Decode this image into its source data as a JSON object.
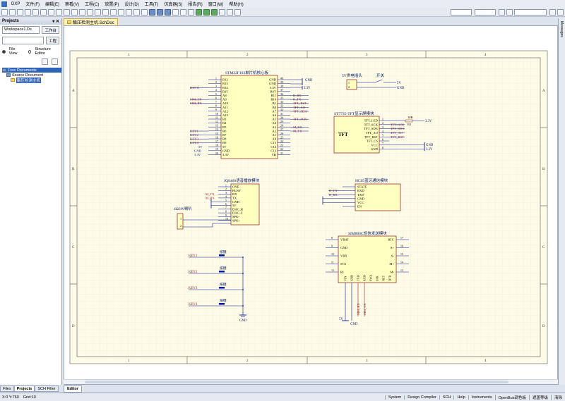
{
  "menu": {
    "app": "DXP",
    "items": [
      "文件(F)",
      "编辑(E)",
      "察看(V)",
      "工程(C)",
      "放置(P)",
      "设计(D)",
      "工具(T)",
      "仿真器(S)",
      "报告(R)",
      "窗口(W)",
      "帮助(H)"
    ]
  },
  "projects_panel": {
    "title": "Projects",
    "workspace_select": "Workspace1.Ds",
    "workspace_btn": "工作台",
    "project_btn": "工程",
    "file_view": "File View",
    "structure_editor": "Structure Editor",
    "tree": {
      "free_documents": "Free Documents",
      "source_documents": "Source Document",
      "file": "酯压检测主机"
    }
  },
  "bottom_tabs": [
    "Files",
    "Projects",
    "SCH Filter"
  ],
  "document_tab": "酯压检测主机.SchDoc",
  "editor_tab": "Editor",
  "right_panel": "Messages",
  "status": {
    "coords": "X:0 Y:760",
    "grid": "Grid:10",
    "tabs": [
      "System",
      "Design Compiler",
      "SCH",
      "Help",
      "Instruments",
      "OpenBus调色板"
    ],
    "mask": "遮盖等级",
    "clear": "清除"
  },
  "sheet": {
    "col_labels": [
      "1",
      "2",
      "3",
      "4"
    ],
    "row_labels": [
      "A",
      "B",
      "C",
      "D"
    ]
  },
  "schematic": {
    "stm32": {
      "title": "STM32F103单片机核心板",
      "left_pins": [
        "B12",
        "B13",
        "B14",
        "B15",
        "A8",
        "A9",
        "A10",
        "A11",
        "A12",
        "A15",
        "B3",
        "B4",
        "B5",
        "B6",
        "B7",
        "B8",
        "B9",
        "5V",
        "GND",
        "3.3V"
      ],
      "left_nums": [
        "1",
        "2",
        "3",
        "4",
        "5",
        "6",
        "7",
        "8",
        "9",
        "10",
        "11",
        "12",
        "13",
        "14",
        "15",
        "16",
        "17",
        "18",
        "19",
        "20"
      ],
      "right_pins": [
        "GND",
        "GND",
        "3.3V",
        "RST",
        "B11",
        "B10",
        "B1",
        "B0",
        "A7",
        "A6",
        "A5",
        "A4",
        "A3",
        "A2",
        "A1",
        "A0",
        "C15",
        "C14",
        "C13",
        "VB"
      ],
      "right_nums": [
        "40",
        "39",
        "38",
        "37",
        "36",
        "35",
        "34",
        "33",
        "32",
        "31",
        "30",
        "29",
        "28",
        "27",
        "26",
        "25",
        "24",
        "23",
        "22",
        "21"
      ],
      "left_nets": {
        "B14": "DHT11",
        "A9": "SIM_TX",
        "A10": "SIM_RX",
        "B6": "KEY1",
        "B7": "KEY2",
        "B8": "KEY3",
        "B9": "KEY4"
      },
      "right_nets": {
        "B11": "B_RX",
        "B10": "B_TX",
        "B1": "TFT_RST",
        "B0": "TFT_AO",
        "A7": "TFT_SDA",
        "A5": "TFT_SCK",
        "A3": "M_RX",
        "A2": "M_TX"
      },
      "gnd": "GND",
      "v33": "3.3V",
      "v5": "5V"
    },
    "power": {
      "title": "5V供电插头",
      "switch": "开关",
      "v5": "5V",
      "gnd": "GND"
    },
    "tft": {
      "title": "ST7735-TFT显示屏模块",
      "body": "TFT",
      "pins": [
        "TFT_LED",
        "TFT_SCK",
        "TFT_SDA",
        "TFT_AO",
        "TFT_RST",
        "TFT_CS",
        "VCC",
        "GND"
      ],
      "nums": [
        "1",
        "2",
        "3",
        "4",
        "5",
        "6",
        "7",
        "8"
      ],
      "nets": [
        "",
        "TFT_SCK",
        "TFT_SDA",
        "TFT_AO",
        "TFT_RST",
        "",
        "",
        ""
      ],
      "resistor": "R1",
      "res_value": "10R",
      "v33": "3.3V",
      "gnd": "GND"
    },
    "jq8400": {
      "title": "JQ8400语音播放模块",
      "pins": [
        "ONE",
        "BUSY",
        "RX",
        "TX",
        "GND",
        "5V",
        "DAC_R",
        "DAC_L",
        "SPK-",
        "SPK+"
      ],
      "nums": [
        "1",
        "2",
        "3",
        "4",
        "5",
        "6",
        "7",
        "8",
        "9",
        "10"
      ],
      "nets": {
        "RX": "M_TX",
        "TX": "M_RX"
      },
      "speaker": "4Ω3W喇叭",
      "spk_pins": [
        "1",
        "2"
      ]
    },
    "hc05": {
      "title": "HC05蓝牙通信模块",
      "pins": [
        "STATE",
        "RXD",
        "TXD",
        "GND",
        "VCC",
        "EN"
      ],
      "nets": {
        "RXD": "B_TX",
        "TXD": "B_RX"
      }
    },
    "sim800": {
      "title": "SIM800C短信发送模块",
      "left_pins": [
        "VBAT",
        "GND",
        "VRX",
        "STA",
        "RI"
      ],
      "left_nums": [
        "8",
        "9",
        "10",
        "11",
        "12"
      ],
      "right_pins": [
        "RTC",
        "S+",
        "S-",
        "M+",
        "M-"
      ],
      "right_nums": [
        "17",
        "16",
        "15",
        "14",
        "13"
      ],
      "bottom_pins": [
        "VIN",
        "GND",
        "TXD",
        "RXD",
        "PWX",
        "SPK",
        "NET",
        "DTR"
      ],
      "bottom_nums": [
        "1",
        "2",
        "3",
        "4",
        "5",
        "6",
        "7"
      ],
      "nets": [
        "SIM_RX",
        "SIM_TX"
      ],
      "v5": "5V",
      "gnd": "GND"
    },
    "keys": {
      "labels": [
        "KEY1",
        "KEY2",
        "KEY3",
        "KEY4"
      ],
      "button": "按键",
      "gnd": "GND"
    }
  }
}
